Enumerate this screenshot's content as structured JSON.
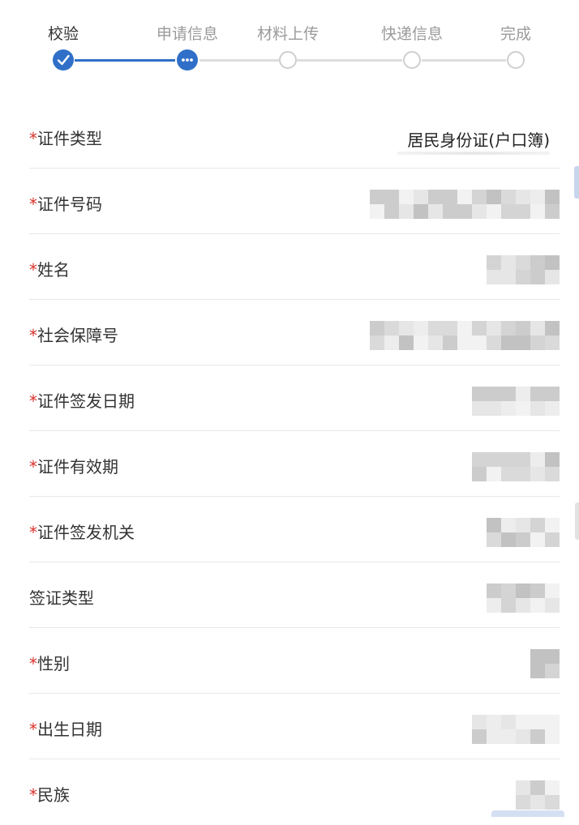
{
  "steps": [
    {
      "label": "校验",
      "state": "done",
      "icon": "check-icon"
    },
    {
      "label": "申请信息",
      "state": "current",
      "icon": "more-dots-icon"
    },
    {
      "label": "材料上传",
      "state": "pending",
      "icon": "empty-circle-icon"
    },
    {
      "label": "快递信息",
      "state": "pending",
      "icon": "empty-circle-icon"
    },
    {
      "label": "完成",
      "state": "pending",
      "icon": "empty-circle-icon"
    }
  ],
  "colors": {
    "accent": "#2f6fc8",
    "required": "#d9332b",
    "inactive_step": "#9a9a9a",
    "divider": "#e8e8e8"
  },
  "form": {
    "rows": [
      {
        "required": true,
        "label": "证件类型",
        "value": "居民身份证(户口簿)"
      },
      {
        "required": true,
        "label": "证件号码",
        "value": null,
        "masked": true
      },
      {
        "required": true,
        "label": "姓名",
        "value": null,
        "masked": true
      },
      {
        "required": true,
        "label": "社会保障号",
        "value": null,
        "masked": true
      },
      {
        "required": true,
        "label": "证件签发日期",
        "value": null,
        "masked": true
      },
      {
        "required": true,
        "label": "证件有效期",
        "value": null,
        "masked": true
      },
      {
        "required": true,
        "label": "证件签发机关",
        "value": null,
        "masked": true
      },
      {
        "required": false,
        "label": "签证类型",
        "value": null,
        "masked": true
      },
      {
        "required": true,
        "label": "性别",
        "value": null,
        "masked": true
      },
      {
        "required": true,
        "label": "出生日期",
        "value": null,
        "masked": true
      },
      {
        "required": true,
        "label": "民族",
        "value": null,
        "masked": true
      }
    ],
    "required_mark": "*"
  }
}
